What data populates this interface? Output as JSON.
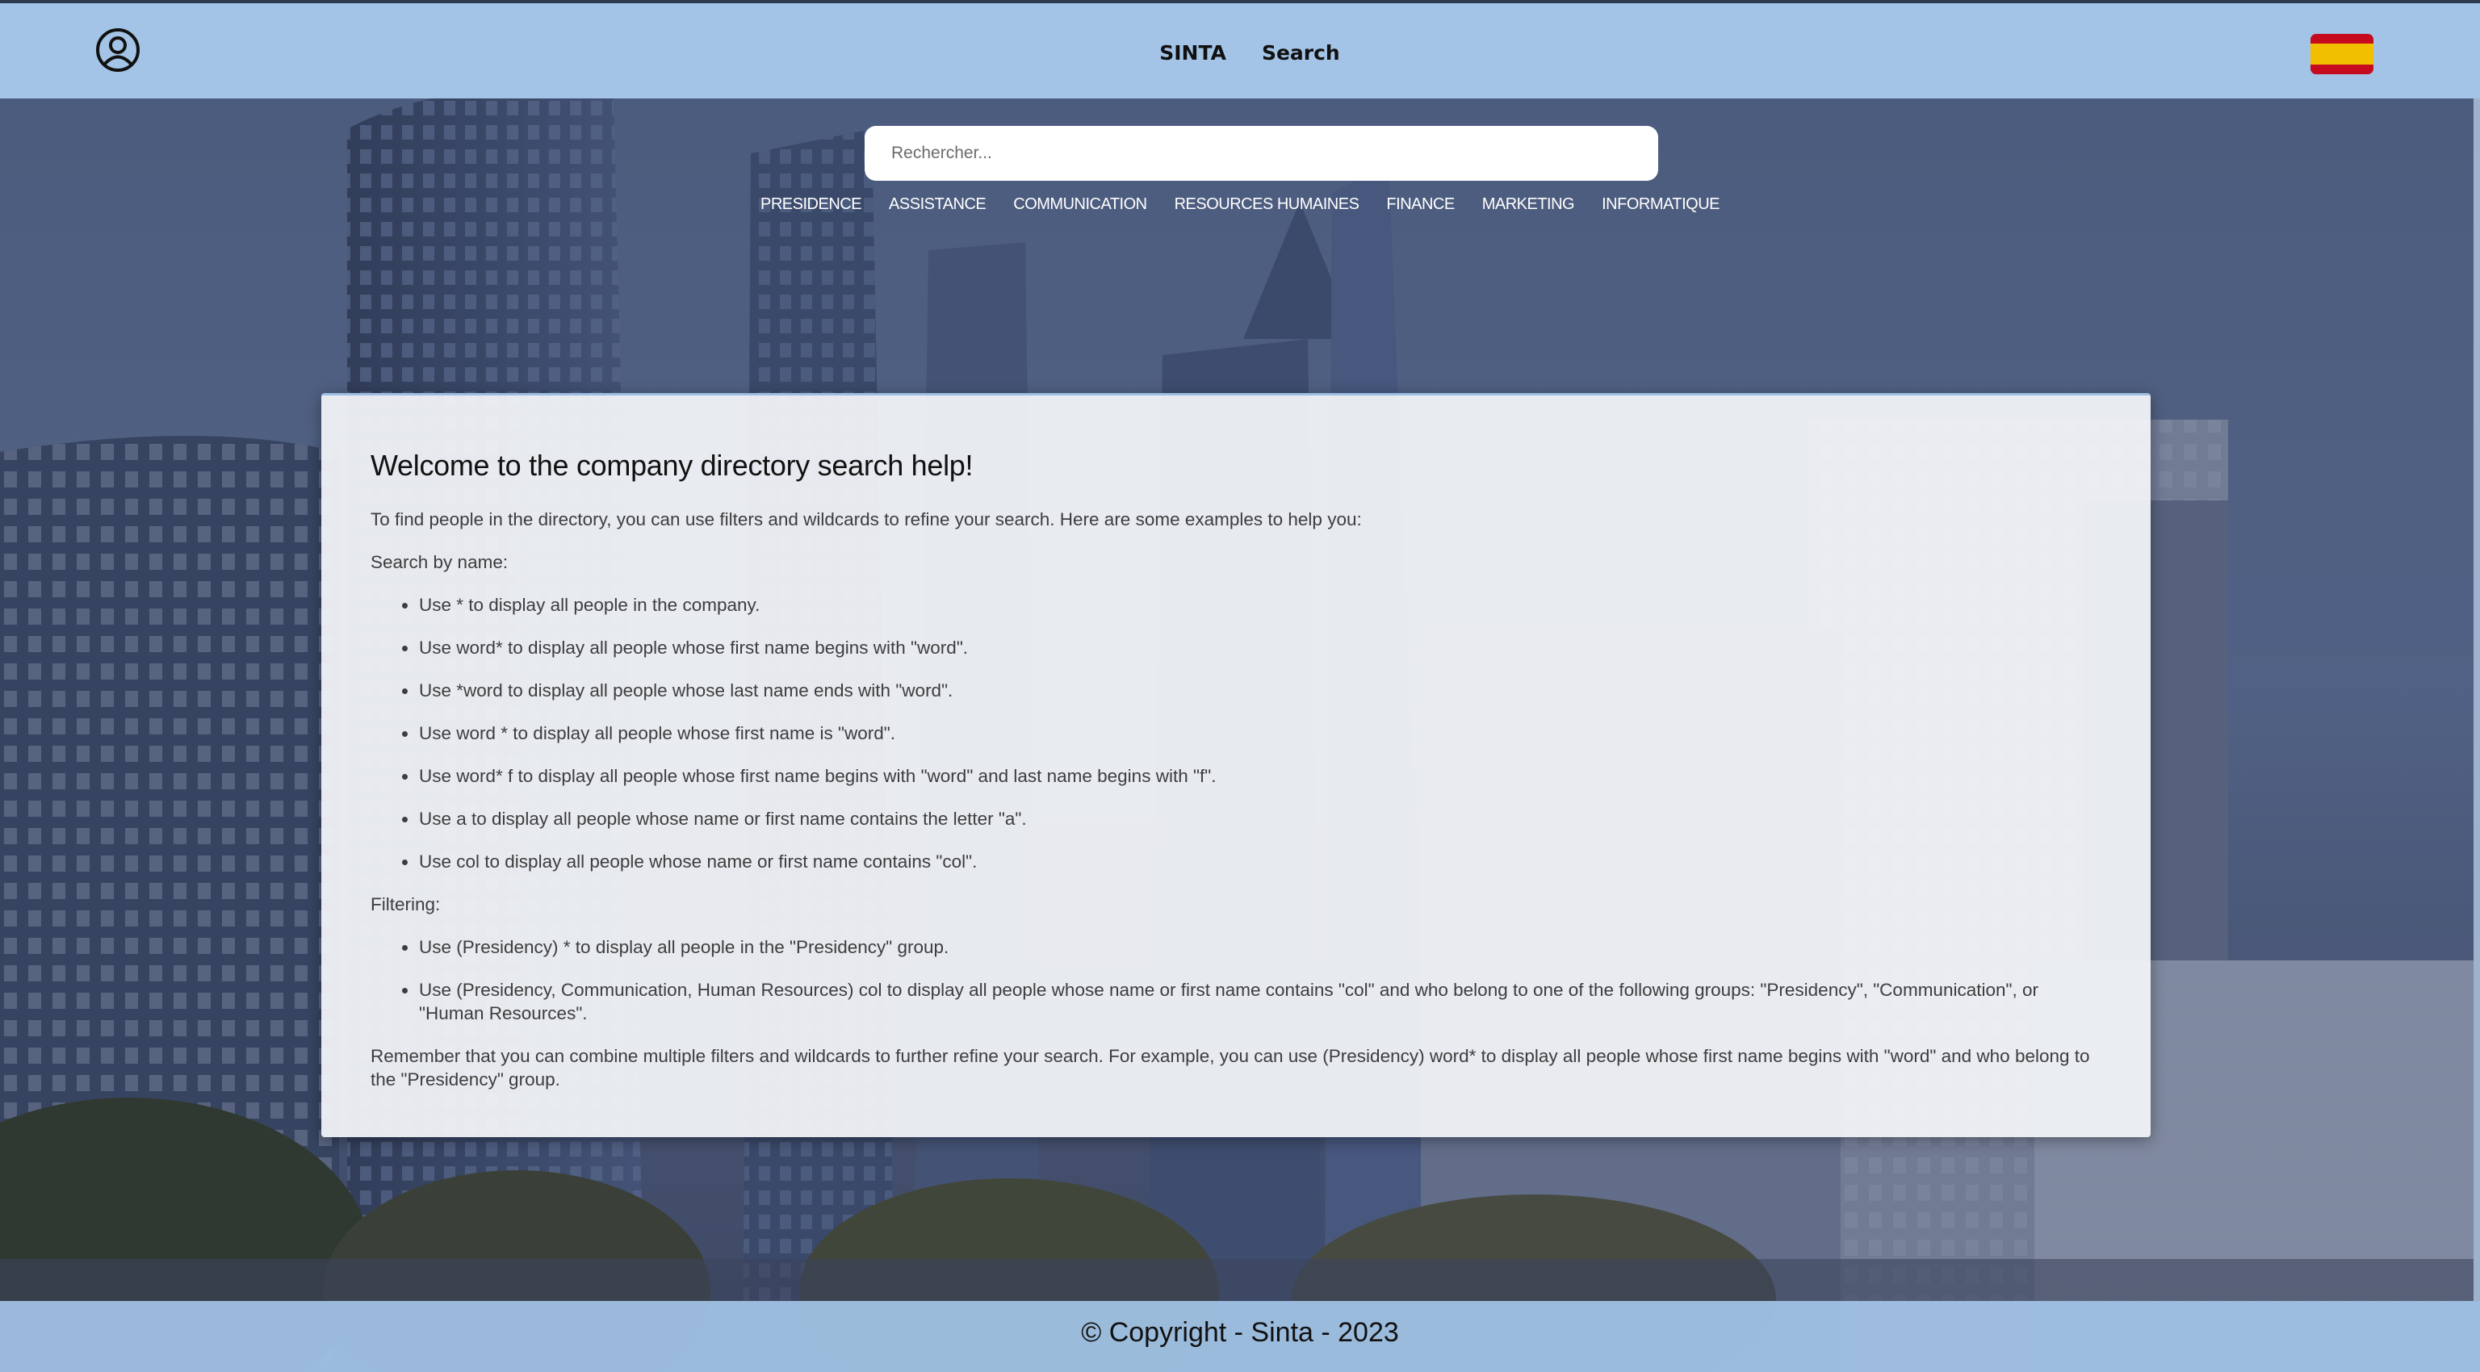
{
  "header": {
    "nav": [
      "SINTA",
      "Search"
    ]
  },
  "search": {
    "placeholder": "Rechercher..."
  },
  "categories": [
    "PRESIDENCE",
    "ASSISTANCE",
    "COMMUNICATION",
    "RESOURCES HUMAINES",
    "FINANCE",
    "MARKETING",
    "INFORMATIQUE"
  ],
  "help": {
    "title": "Welcome to the company directory search help!",
    "intro": "To find people in the directory, you can use filters and wildcards to refine your search. Here are some examples to help you:",
    "by_name_heading": "Search by name:",
    "by_name_items": [
      "Use * to display all people in the company.",
      "Use word* to display all people whose first name begins with \"word\".",
      "Use *word to display all people whose last name ends with \"word\".",
      "Use word * to display all people whose first name is \"word\".",
      "Use word* f to display all people whose first name begins with \"word\" and last name begins with \"f\".",
      "Use a to display all people whose name or first name contains the letter \"a\".",
      "Use col to display all people whose name or first name contains \"col\"."
    ],
    "filtering_heading": "Filtering:",
    "filtering_items": [
      "Use (Presidency) * to display all people in the \"Presidency\" group.",
      "Use (Presidency, Communication, Human Resources) col to display all people whose name or first name contains \"col\" and who belong to one of the following groups: \"Presidency\", \"Communication\", or \"Human Resources\"."
    ],
    "closing": "Remember that you can combine multiple filters and wildcards to further refine your search. For example, you can use (Presidency) word* to display all people whose first name begins with \"word\" and who belong to the \"Presidency\" group."
  },
  "footer": {
    "copyright": "© Copyright - Sinta - 2023"
  },
  "colors": {
    "topbar": "#a3c4e6",
    "flag_red": "#c60b1e",
    "flag_yellow": "#f1bf00"
  },
  "icons": {
    "user": "user-circle-icon",
    "language": "spain-flag-icon"
  }
}
